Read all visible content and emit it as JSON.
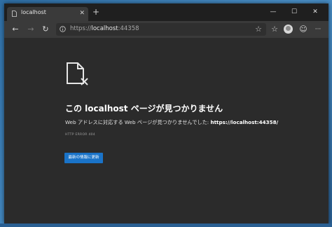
{
  "tab": {
    "title": "localhost",
    "close_glyph": "✕"
  },
  "new_tab_glyph": "+",
  "window_controls": {
    "minimize": "—",
    "maximize": "☐",
    "close": "✕"
  },
  "toolbar": {
    "back": "←",
    "forward": "→",
    "refresh": "↻",
    "favorites": "☆",
    "collections": "☆",
    "emoji": "☺",
    "more": "···"
  },
  "address": {
    "scheme": "https://",
    "host": "localhost",
    "port": ":44358"
  },
  "page": {
    "heading": "この localhost ページが見つかりません",
    "desc_prefix": "Web アドレスに対応する Web ページが見つかりませんでした: ",
    "desc_url": "https://localhost:44358/",
    "error_code": "HTTP ERROR 404",
    "refresh_button": "最新の情報に更新"
  },
  "colors": {
    "accent": "#1a73c8",
    "background": "#2b2b2b",
    "toolbar": "#3a3a3a",
    "titlebar": "#1f1f1f"
  },
  "icons": [
    "page-favicon-icon",
    "info-icon",
    "star-icon",
    "favorites-icon",
    "profile-avatar",
    "emoji-icon",
    "more-icon",
    "broken-document-icon"
  ]
}
